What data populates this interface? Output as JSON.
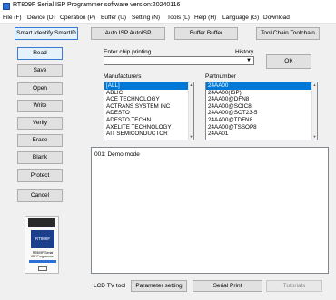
{
  "window": {
    "title": "RT809F Serial ISP Programmer software version:20240116"
  },
  "menu": [
    {
      "label": "File (F)"
    },
    {
      "label": "Device (D)"
    },
    {
      "label": "Operation (P)"
    },
    {
      "label": "Buffer (U)"
    },
    {
      "label": "Setting (N)"
    },
    {
      "label": "Tools (L)"
    },
    {
      "label": "Help (H)"
    },
    {
      "label": "Language (G)"
    },
    {
      "label": "Download"
    }
  ],
  "toolbar": {
    "smart_identify": "Smart Identify SmartID",
    "auto_isp": "Auto ISP AutoISP",
    "buffer": "Buffer Buffer",
    "tool_chain": "Tool Chain Toolchain"
  },
  "sidebar": {
    "read": "Read",
    "save": "Save",
    "open": "Open",
    "write": "Write",
    "verify": "Verify",
    "erase": "Erase",
    "blank": "Blank",
    "protect": "Protect",
    "cancel": "Cancel"
  },
  "chip": {
    "label": "Enter chip printing",
    "history": "History",
    "ok": "OK",
    "value": ""
  },
  "manufacturers": {
    "label": "Manufacturers",
    "items": [
      "[ALL]",
      "ABLIC",
      "ACE TECHNOLOGY",
      "ACTRANS SYSTEM INC",
      "ADESTO",
      "ADESTO TECHN.",
      "AXELITE TECHNOLOGY",
      "AIT SEMICONDUCTOR"
    ]
  },
  "partnumber": {
    "label": "Partnumber",
    "items": [
      "24AA00",
      "24AA00(ISP)",
      "24AA00@DFN8",
      "24AA00@SOIC8",
      "24AA00@SOT23-5",
      "24AA00@TDFN8",
      "24AA00@TSSOP8",
      "24AA01"
    ]
  },
  "log": {
    "lines": [
      "001:  Demo mode"
    ]
  },
  "bottom": {
    "lcd": "LCD TV tool",
    "param": "Parameter setting",
    "serial": "Serial Print",
    "tutorials": "Tutorials"
  },
  "device_image": {
    "brand": "RT809F",
    "caption_1": "RT809F Serial",
    "caption_2": "ISP Programmer"
  }
}
